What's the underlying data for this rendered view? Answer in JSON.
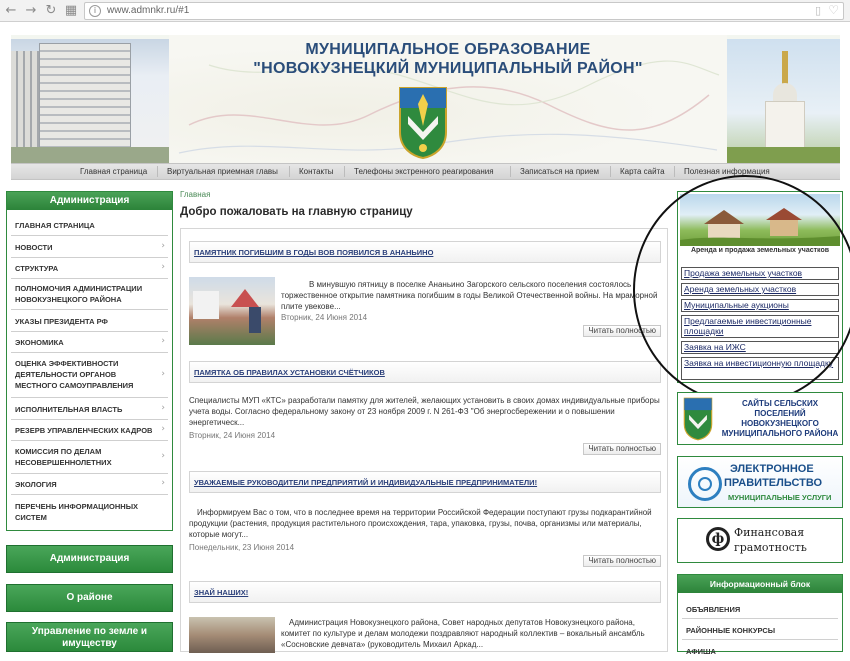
{
  "browser": {
    "url": "www.admnkr.ru/#1",
    "back_icon": "arrow-left-icon",
    "forward_icon": "arrow-right-icon",
    "reload_icon": "reload-icon",
    "apps_icon": "apps-grid-icon"
  },
  "header": {
    "title_line1": "МУНИЦИПАЛЬНОЕ ОБРАЗОВАНИЕ",
    "title_line2": "\"НОВОКУЗНЕЦКИЙ МУНИЦИПАЛЬНЫЙ РАЙОН\"",
    "title_color": "#2a4d7a"
  },
  "topnav": [
    "Главная страница",
    "Виртуальная приемная главы",
    "Контакты",
    "Телефоны экстренного реагирования",
    "Записаться на прием",
    "Карта сайта",
    "Полезная информация"
  ],
  "left_menu": {
    "header": "Администрация",
    "items": [
      {
        "label": "ГЛАВНАЯ СТРАНИЦА",
        "arrow": ""
      },
      {
        "label": "НОВОСТИ",
        "arrow": "›"
      },
      {
        "label": "СТРУКТУРА",
        "arrow": "›"
      },
      {
        "label": "ПОЛНОМОЧИЯ АДМИНИСТРАЦИИ НОВОКУЗНЕЦКОГО РАЙОНА",
        "arrow": ""
      },
      {
        "label": "УКАЗЫ ПРЕЗИДЕНТА РФ",
        "arrow": ""
      },
      {
        "label": "ЭКОНОМИКА",
        "arrow": "›"
      },
      {
        "label": "ОЦЕНКА ЭФФЕКТИВНОСТИ ДЕЯТЕЛЬНОСТИ ОРГАНОВ МЕСТНОГО САМОУПРАВЛЕНИЯ",
        "arrow": "›"
      },
      {
        "label": "ИСПОЛНИТЕЛЬНАЯ ВЛАСТЬ",
        "arrow": "›"
      },
      {
        "label": "РЕЗЕРВ УПРАВЛЕНЧЕСКИХ КАДРОВ",
        "arrow": "›"
      },
      {
        "label": "КОМИССИЯ ПО ДЕЛАМ НЕСОВЕРШЕННОЛЕТНИХ",
        "arrow": "›"
      },
      {
        "label": "ЭКОЛОГИЯ",
        "arrow": "›"
      },
      {
        "label": "ПЕРЕЧЕНЬ ИНФОРМАЦИОННЫХ СИСТЕМ",
        "arrow": ""
      }
    ],
    "buttons": [
      "Администрация",
      "О районе",
      "Управление по земле и имуществу"
    ],
    "accent": "#2c8339"
  },
  "center": {
    "breadcrumb": "Главная",
    "heading": "Добро пожаловать на главную страницу",
    "read_more": "Читать полностью",
    "articles": [
      {
        "title": "ПАМЯТНИК ПОГИБШИМ В ГОДЫ ВОВ ПОЯВИЛСЯ В АНАНЬИНО",
        "text": "В минувшую пятницу в поселке Ананьино Загорского сельского поселения состоялось торжественное открытие памятника погибшим в годы Великой Отечественной войны. На мраморной плите увековe...",
        "date": "Вторник, 24 Июня 2014"
      },
      {
        "title": "ПАМЯТКА ОБ ПРАВИЛАХ УСТАНОВКИ СЧЁТЧИКОВ",
        "text": "Специалисты МУП «КТС» разработали памятку для жителей, желающих установить в своих домах индивидуальные приборы учета воды. Согласно федеральному закону от 23 ноября 2009 г. N 261-ФЗ \"Об энергосбережении и о повышении энергетическ...",
        "date": "Вторник, 24 Июня 2014"
      },
      {
        "title": "УВАЖАЕМЫЕ РУКОВОДИТЕЛИ ПРЕДПРИЯТИЙ И ИНДИВИДУАЛЬНЫЕ ПРЕДПРИНИМАТЕЛИ!",
        "text": "Информируем Вас о том, что в последнее время на территории Российской Федерации поступают грузы подкарантийной продукции (растения, продукция растительного происхождения, тара, упаковка, грузы, почва, организмы или материалы, которые могут...",
        "date": "Понедельник, 23 Июня 2014"
      },
      {
        "title": "ЗНАЙ НАШИХ!",
        "text": "Администрация Новокузнецкого района, Совет народных депутатов Новокузнецкого района, комитет по культуре и делам молодежи поздравляют народный коллектив – вокальный ансамбль «Сосновские девчата» (руководитель Михаил Аркад...",
        "date": ""
      }
    ]
  },
  "right": {
    "land_caption": "Аренда и продажа земельных участков",
    "land_links": [
      "Продажа земельных участков",
      "Аренда земельных участков",
      "Муниципальные аукционы",
      "Предлагаемые инвестиционные площадки",
      "Заявка на ИЖС",
      "Заявка на инвестиционную площадку"
    ],
    "sites_banner": "САЙТЫ СЕЛЬСКИХ ПОСЕЛЕНИЙ НОВОКУЗНЕЦКОГО МУНИЦИПАЛЬНОГО РАЙОНА",
    "egov_line1": "ЭЛЕКТРОННОЕ",
    "egov_line2": "ПРАВИТЕЛЬСТВО",
    "egov_line3": "МУНИЦИПАЛЬНЫЕ УСЛУГИ",
    "fin_line1": "Финансовая",
    "fin_line2": "грамотность",
    "info_header": "Информационный блок",
    "info_items": [
      "ОБЪЯВЛЕНИЯ",
      "РАЙОННЫЕ КОНКУРСЫ",
      "АФИША"
    ]
  }
}
